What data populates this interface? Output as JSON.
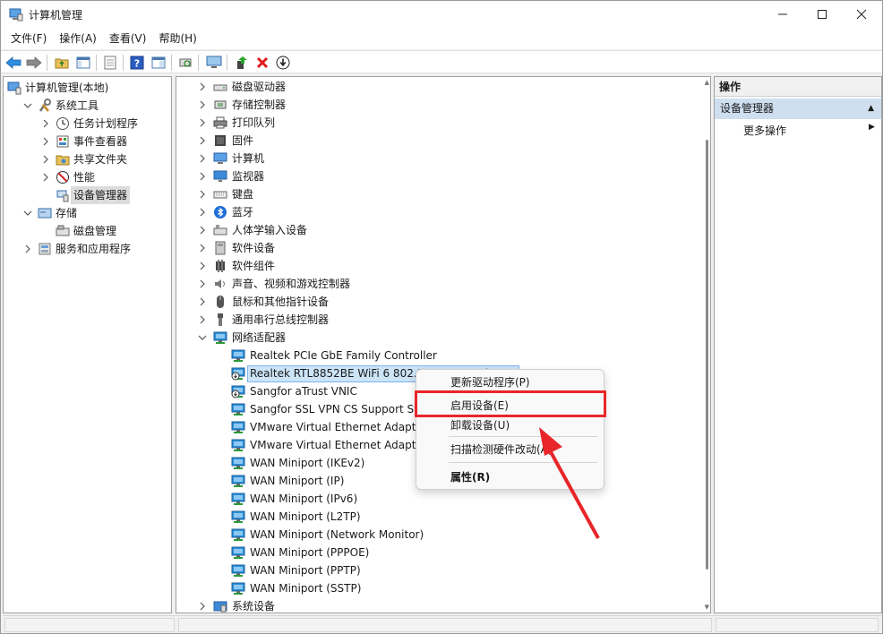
{
  "window": {
    "title": "计算机管理"
  },
  "menu": [
    "文件(F)",
    "操作(A)",
    "查看(V)",
    "帮助(H)"
  ],
  "left_tree": [
    {
      "label": "计算机管理(本地)",
      "indent": 0,
      "chevron": "",
      "icon": "computer-management-icon"
    },
    {
      "label": "系统工具",
      "indent": 1,
      "chevron": "down",
      "icon": "system-tools-icon"
    },
    {
      "label": "任务计划程序",
      "indent": 2,
      "chevron": "right",
      "icon": "task-scheduler-icon"
    },
    {
      "label": "事件查看器",
      "indent": 2,
      "chevron": "right",
      "icon": "event-viewer-icon"
    },
    {
      "label": "共享文件夹",
      "indent": 2,
      "chevron": "right",
      "icon": "shared-folders-icon"
    },
    {
      "label": "性能",
      "indent": 2,
      "chevron": "right",
      "icon": "performance-icon"
    },
    {
      "label": "设备管理器",
      "indent": 2,
      "chevron": "",
      "icon": "device-manager-icon",
      "selected": true
    },
    {
      "label": "存储",
      "indent": 1,
      "chevron": "down",
      "icon": "storage-icon"
    },
    {
      "label": "磁盘管理",
      "indent": 2,
      "chevron": "",
      "icon": "disk-management-icon"
    },
    {
      "label": "服务和应用程序",
      "indent": 1,
      "chevron": "right",
      "icon": "services-apps-icon"
    }
  ],
  "device_tree": [
    {
      "label": "磁盘驱动器",
      "level": 0,
      "chevron": "right",
      "icon": "disk-drive-icon"
    },
    {
      "label": "存储控制器",
      "level": 0,
      "chevron": "right",
      "icon": "storage-controller-icon"
    },
    {
      "label": "打印队列",
      "level": 0,
      "chevron": "right",
      "icon": "print-queue-icon"
    },
    {
      "label": "固件",
      "level": 0,
      "chevron": "right",
      "icon": "firmware-icon"
    },
    {
      "label": "计算机",
      "level": 0,
      "chevron": "right",
      "icon": "computer-icon"
    },
    {
      "label": "监视器",
      "level": 0,
      "chevron": "right",
      "icon": "monitor-icon"
    },
    {
      "label": "键盘",
      "level": 0,
      "chevron": "right",
      "icon": "keyboard-icon"
    },
    {
      "label": "蓝牙",
      "level": 0,
      "chevron": "right",
      "icon": "bluetooth-icon"
    },
    {
      "label": "人体学输入设备",
      "level": 0,
      "chevron": "right",
      "icon": "hid-icon"
    },
    {
      "label": "软件设备",
      "level": 0,
      "chevron": "right",
      "icon": "software-device-icon"
    },
    {
      "label": "软件组件",
      "level": 0,
      "chevron": "right",
      "icon": "software-component-icon"
    },
    {
      "label": "声音、视频和游戏控制器",
      "level": 0,
      "chevron": "right",
      "icon": "sound-icon"
    },
    {
      "label": "鼠标和其他指针设备",
      "level": 0,
      "chevron": "right",
      "icon": "mouse-icon"
    },
    {
      "label": "通用串行总线控制器",
      "level": 0,
      "chevron": "right",
      "icon": "usb-icon"
    },
    {
      "label": "网络适配器",
      "level": 0,
      "chevron": "down",
      "icon": "network-adapter-icon"
    },
    {
      "label": "Realtek PCIe GbE Family Controller",
      "level": 1,
      "chevron": "",
      "icon": "network-adapter-icon"
    },
    {
      "label": "Realtek RTL8852BE WiFi 6 802.11ax PCIe Adapter",
      "level": 1,
      "chevron": "",
      "icon": "network-adapter-disabled-icon",
      "selected": true
    },
    {
      "label": "Sangfor aTrust VNIC",
      "level": 1,
      "chevron": "",
      "icon": "network-adapter-disabled-icon"
    },
    {
      "label": "Sangfor SSL VPN CS Support System VNIC",
      "level": 1,
      "chevron": "",
      "icon": "network-adapter-icon"
    },
    {
      "label": "VMware Virtual Ethernet Adapter for VMnet1",
      "level": 1,
      "chevron": "",
      "icon": "network-adapter-icon"
    },
    {
      "label": "VMware Virtual Ethernet Adapter for VMnet8",
      "level": 1,
      "chevron": "",
      "icon": "network-adapter-icon"
    },
    {
      "label": "WAN Miniport (IKEv2)",
      "level": 1,
      "chevron": "",
      "icon": "network-adapter-icon"
    },
    {
      "label": "WAN Miniport (IP)",
      "level": 1,
      "chevron": "",
      "icon": "network-adapter-icon"
    },
    {
      "label": "WAN Miniport (IPv6)",
      "level": 1,
      "chevron": "",
      "icon": "network-adapter-icon"
    },
    {
      "label": "WAN Miniport (L2TP)",
      "level": 1,
      "chevron": "",
      "icon": "network-adapter-icon"
    },
    {
      "label": "WAN Miniport (Network Monitor)",
      "level": 1,
      "chevron": "",
      "icon": "network-adapter-icon"
    },
    {
      "label": "WAN Miniport (PPPOE)",
      "level": 1,
      "chevron": "",
      "icon": "network-adapter-icon"
    },
    {
      "label": "WAN Miniport (PPTP)",
      "level": 1,
      "chevron": "",
      "icon": "network-adapter-icon"
    },
    {
      "label": "WAN Miniport (SSTP)",
      "level": 1,
      "chevron": "",
      "icon": "network-adapter-icon"
    },
    {
      "label": "系统设备",
      "level": 0,
      "chevron": "right",
      "icon": "system-device-icon"
    }
  ],
  "actions": {
    "header": "操作",
    "group": "设备管理器",
    "more": "更多操作"
  },
  "context_menu": {
    "update_driver": "更新驱动程序(P)",
    "enable_device": "启用设备(E)",
    "uninstall_device": "卸载设备(U)",
    "scan_hardware": "扫描检测硬件改动(A)",
    "properties": "属性(R)"
  },
  "colors": {
    "highlight": "#e8262a",
    "selection": "#cce4f7",
    "actions_group": "#cfdff0",
    "network_icon": "#2b8fd6"
  }
}
